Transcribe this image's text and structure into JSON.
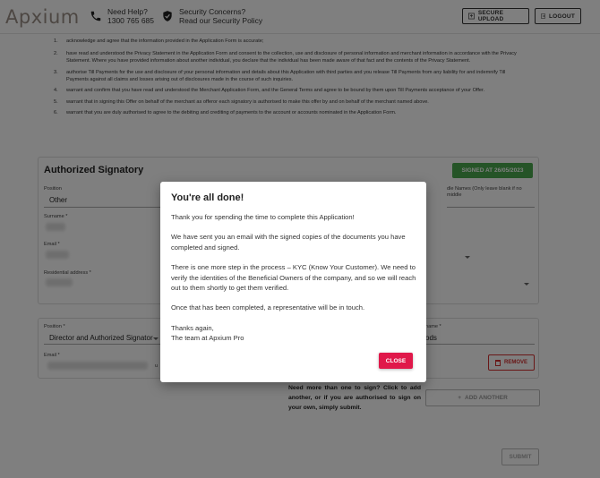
{
  "header": {
    "logo": "Apxium",
    "help_title": "Need Help?",
    "help_phone": "1300 765 685",
    "security_title": "Security Concerns?",
    "security_link": "Read our Security Policy",
    "secure_upload_label": "SECURE UPLOAD",
    "logout_label": "LOGOUT"
  },
  "terms": [
    {
      "num": "1.",
      "text": "acknowledge and agree that the information provided in the Application Form is accurate;"
    },
    {
      "num": "2.",
      "text": "have read and understood the Privacy Statement in the Application Form and consent to the collection, use and disclosure of personal information and merchant information in accordance with the Privacy Statement. Where you have provided information about another individual, you declare that the individual has been made aware of that fact and the contents of the Privacy Statement."
    },
    {
      "num": "3.",
      "text": "authorise Till Payments for the use and disclosure of your personal information and details about this Application with third parties and you release Till Payments from any liability for and indemnify Till Payments against all claims and losses arising out of disclosures made in the course of such inquiries."
    },
    {
      "num": "4.",
      "text": "warrant and confirm that you have read and understood the Merchant Application Form, and the General Terms and agree to be bound by them upon Till Payments acceptance of your Offer."
    },
    {
      "num": "5.",
      "text": "warrant that in signing this Offer on behalf of the merchant as offeror each signatory is authorised to make this offer by and on behalf of the merchant named above."
    },
    {
      "num": "6.",
      "text": "warrant that you are duly authorised to agree to the debiting and crediting of payments to the account or accounts nominated in the Application Form."
    }
  ],
  "form": {
    "section_title": "Authorized Signatory",
    "signed_badge": "SIGNED AT 26/05/2023",
    "position_label": "Position",
    "position_value": "Other",
    "middle_names_label": "dle Names (Only leave blank if no middle",
    "surname_label": "Surname *",
    "email_label": "Email *",
    "address_label": "Residential address *",
    "position2_label": "Position *",
    "position2_value": "Director and Authorized Signator",
    "email2_label": "Email *",
    "email2_suffix": "u",
    "surname2_label": "name *",
    "surname2_value": "ods",
    "remove_label": "REMOVE",
    "need_more_text": "Need more than one to sign? Click to add another, or if you are authorised to sign on your own, simply submit.",
    "add_another_label": "ADD ANOTHER",
    "submit_label": "SUBMIT"
  },
  "modal": {
    "title": "You're all done!",
    "p1": "Thank you for spending the time to complete this Application!",
    "p2": "We have sent you an email with the signed copies of the documents you have completed and signed.",
    "p3": "There is one more step in the process – KYC (Know Your Customer). We need to verify the identities of the Beneficial Owners of the company, and so we will reach out to them shortly to get them verified.",
    "p4": "Once that has been completed, a representative will be in touch.",
    "p5a": "Thanks again,",
    "p5b": "The team at Apxium Pro",
    "close_label": "CLOSE"
  }
}
